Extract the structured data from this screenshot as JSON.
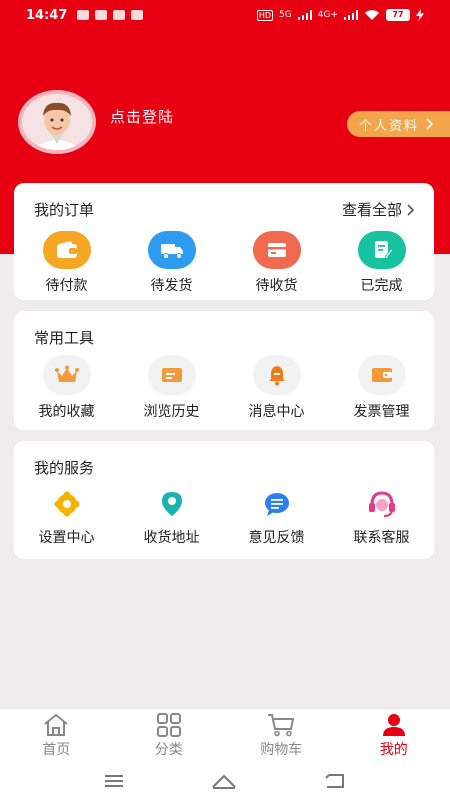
{
  "status_bar": {
    "time": "14:47",
    "network_tags": [
      "HD",
      "5G",
      "4G+"
    ],
    "battery": "77"
  },
  "header": {
    "login_text": "点击登陆",
    "profile_button": "个人资料"
  },
  "orders": {
    "title": "我的订单",
    "view_all": "查看全部",
    "items": [
      {
        "label": "待付款",
        "icon": "wallet-icon",
        "color": "#f5a623"
      },
      {
        "label": "待发货",
        "icon": "truck-icon",
        "color": "#2d9cf0"
      },
      {
        "label": "待收货",
        "icon": "package-icon",
        "color": "#f06a50"
      },
      {
        "label": "已完成",
        "icon": "completed-doc-icon",
        "color": "#17c2a0"
      }
    ]
  },
  "tools": {
    "title": "常用工具",
    "items": [
      {
        "label": "我的收藏",
        "icon": "crown-icon"
      },
      {
        "label": "浏览历史",
        "icon": "history-card-icon"
      },
      {
        "label": "消息中心",
        "icon": "bell-icon"
      },
      {
        "label": "发票管理",
        "icon": "invoice-wallet-icon"
      }
    ]
  },
  "services": {
    "title": "我的服务",
    "items": [
      {
        "label": "设置中心",
        "icon": "gear-icon"
      },
      {
        "label": "收货地址",
        "icon": "location-pin-icon"
      },
      {
        "label": "意见反馈",
        "icon": "feedback-bubble-icon"
      },
      {
        "label": "联系客服",
        "icon": "headset-icon"
      }
    ]
  },
  "tabbar": {
    "items": [
      {
        "label": "首页",
        "icon": "home-icon",
        "active": false
      },
      {
        "label": "分类",
        "icon": "grid-icon",
        "active": false
      },
      {
        "label": "购物车",
        "icon": "cart-icon",
        "active": false
      },
      {
        "label": "我的",
        "icon": "user-icon",
        "active": true
      }
    ]
  },
  "colors": {
    "brand_red": "#e60012",
    "accent_orange": "#f2a54a",
    "background": "#efedea"
  }
}
